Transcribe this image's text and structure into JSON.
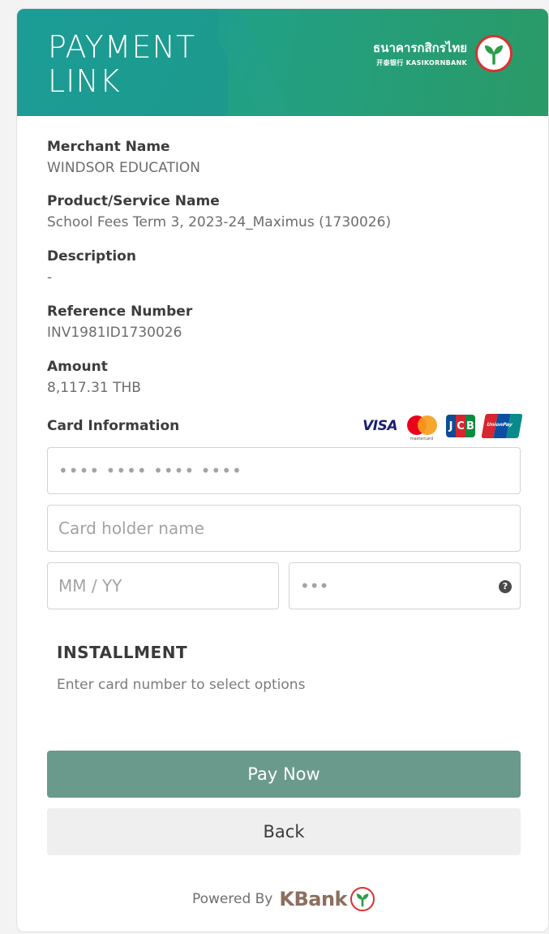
{
  "header": {
    "title_line1": "PAYMENT",
    "title_line2": "LINK",
    "bank_name_thai": "ธนาคารกสิกรไทย",
    "bank_name_en": "开泰银行 KASIKORNBANK"
  },
  "fields": {
    "merchant_label": "Merchant Name",
    "merchant_value": "WINDSOR EDUCATION",
    "product_label": "Product/Service Name",
    "product_value": "School Fees Term 3, 2023-24_Maximus (1730026)",
    "description_label": "Description",
    "description_value": "-",
    "reference_label": "Reference Number",
    "reference_value": "INV1981ID1730026",
    "amount_label": "Amount",
    "amount_value": "8,117.31 THB"
  },
  "card": {
    "section_label": "Card Information",
    "brands": [
      "VISA",
      "mastercard",
      "JCB",
      "UnionPay"
    ],
    "visa_text": "VISA",
    "mc_caption": "mastercard",
    "jcb_letters": [
      "J",
      "C",
      "B"
    ],
    "unionpay_text": "UnionPay",
    "number_placeholder": "•••• •••• •••• ••••",
    "holder_placeholder": "Card holder name",
    "expiry_placeholder": "MM / YY",
    "cvv_placeholder": "•••",
    "help_glyph": "?"
  },
  "installment": {
    "title": "INSTALLMENT",
    "hint": "Enter card number to select options"
  },
  "actions": {
    "pay_label": "Pay Now",
    "back_label": "Back"
  },
  "footer": {
    "powered_by": "Powered By",
    "brand": "KBank"
  },
  "colors": {
    "header_start": "#1a9a8f",
    "header_end": "#2a9a67",
    "pay_button": "#6a9a8c",
    "back_button": "#efefef",
    "logo_ring": "#d9322e",
    "logo_leaf": "#2e9c4a"
  },
  "icons": {
    "bank_logo": "kasikorn-leaf-icon",
    "help": "question-circle-icon",
    "footer_logo": "kasikorn-leaf-icon"
  }
}
